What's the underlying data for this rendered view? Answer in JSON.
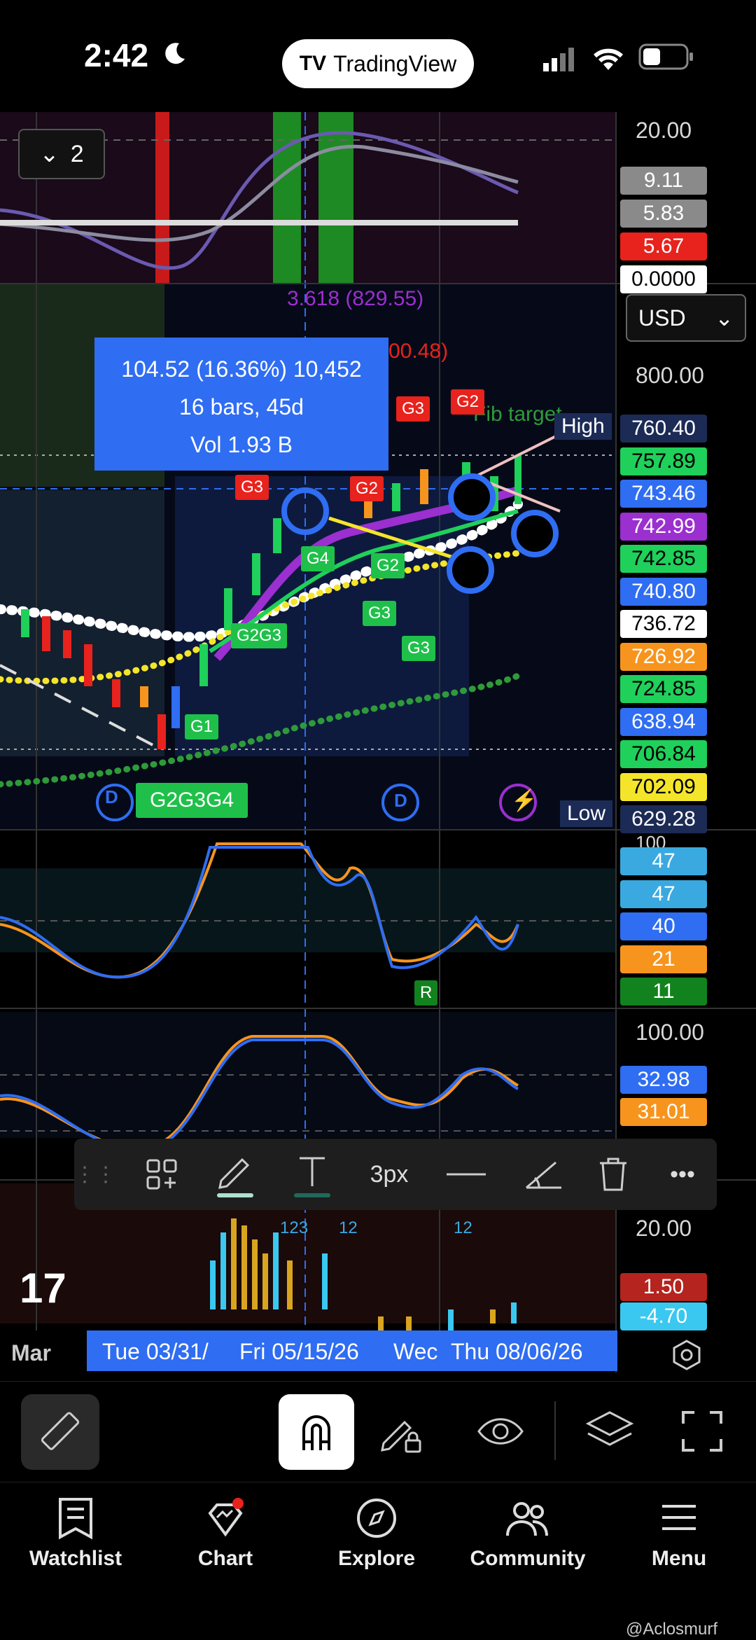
{
  "status": {
    "time": "2:42",
    "app_pill": "TradingView"
  },
  "chart": {
    "indicator_collapse_count": "2",
    "currency": "USD",
    "fib_label": "3.618 (829.55)",
    "fib_partial": "00.48)",
    "fib_target": "Fib target",
    "measure": {
      "line1": "104.52 (16.36%) 10,452",
      "line2": "16 bars, 45d",
      "line3": "Vol 1.93 B"
    },
    "high_label": "High",
    "low_label": "Low",
    "signals": [
      "G2G3G4",
      "G1",
      "G2G3",
      "G3",
      "G3",
      "G4",
      "G2",
      "G3",
      "G2",
      "G3",
      "G2",
      "R"
    ],
    "axis": {
      "top1": "20.00",
      "price_800": "800.00",
      "osc_100": "100",
      "osc2_100": "100.00",
      "vol_20": "20.00"
    },
    "top_tags": [
      {
        "v": "9.11",
        "c": "#8a8a8a"
      },
      {
        "v": "5.83",
        "c": "#8a8a8a"
      },
      {
        "v": "5.67",
        "c": "#e8221c"
      },
      {
        "v": "0.0000",
        "c": "#ffffff"
      }
    ],
    "price_tags": [
      {
        "v": "760.40",
        "c": "#1c2b55"
      },
      {
        "v": "757.89",
        "c": "#1fd05a"
      },
      {
        "v": "743.46",
        "c": "#2f6df2"
      },
      {
        "v": "742.99",
        "c": "#9b2fd0"
      },
      {
        "v": "742.85",
        "c": "#1fd05a"
      },
      {
        "v": "740.80",
        "c": "#2f6df2"
      },
      {
        "v": "736.72",
        "c": "#ffffff"
      },
      {
        "v": "726.92",
        "c": "#f7941d"
      },
      {
        "v": "724.85",
        "c": "#1fd05a"
      },
      {
        "v": "638.94",
        "c": "#2f6df2"
      },
      {
        "v": "706.84",
        "c": "#1fd05a"
      },
      {
        "v": "702.09",
        "c": "#f5e52a"
      },
      {
        "v": "629.28",
        "c": "#1c2b55"
      }
    ],
    "osc_tags": [
      {
        "v": "47",
        "c": "#3aa9e0"
      },
      {
        "v": "47",
        "c": "#3aa9e0"
      },
      {
        "v": "40",
        "c": "#2f6df2"
      },
      {
        "v": "21",
        "c": "#f7941d"
      },
      {
        "v": "11",
        "c": "#12821f"
      }
    ],
    "osc2_tags": [
      {
        "v": "32.98",
        "c": "#2f6df2"
      },
      {
        "v": "31.01",
        "c": "#f7941d"
      }
    ],
    "vol_tags": [
      {
        "v": "1.50",
        "c": "#b5241e"
      },
      {
        "v": "-4.70",
        "c": "#3ac8f0"
      }
    ],
    "vol_numbers": [
      "123",
      "12",
      "12"
    ],
    "time_axis": {
      "left": "Mar",
      "t1": "Tue 03/31/",
      "t2": "Fri 05/15/26",
      "t3": "Wec",
      "t4": "Thu 08/06/26"
    }
  },
  "drawing_toolbar": {
    "stroke": "3px"
  },
  "nav": [
    "Watchlist",
    "Chart",
    "Explore",
    "Community",
    "Menu"
  ],
  "watermark": "@Aclosmurf"
}
